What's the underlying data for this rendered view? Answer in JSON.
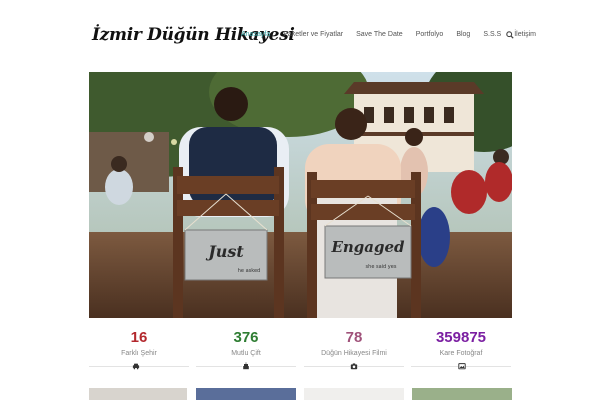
{
  "site": {
    "logo_text": "İzmir Düğün Hikayesi"
  },
  "nav": {
    "items": [
      {
        "label": "Anasayfa",
        "active": true
      },
      {
        "label": "Paketler ve Fiyatlar",
        "active": false
      },
      {
        "label": "Save The Date",
        "active": false
      },
      {
        "label": "Portfolyo",
        "active": false
      },
      {
        "label": "Blog",
        "active": false
      },
      {
        "label": "S.S.S",
        "active": false
      },
      {
        "label": "İletişim",
        "active": false
      }
    ],
    "search_icon": "search-icon",
    "active_color": "#3aa6a6"
  },
  "hero": {
    "signs": {
      "left": "Just",
      "right": "Engaged",
      "left_small": "he asked",
      "right_small": "she said yes"
    }
  },
  "stats": [
    {
      "value": "16",
      "label": "Farklı Şehir",
      "color": "#b3282d",
      "icon": "car-icon"
    },
    {
      "value": "376",
      "label": "Mutlu Çift",
      "color": "#2e7d32",
      "icon": "cake-icon"
    },
    {
      "value": "78",
      "label": "Düğün Hikayesi Filmi",
      "color": "#a0527a",
      "icon": "camera-icon"
    },
    {
      "value": "359875",
      "label": "Kare Fotoğraf",
      "color": "#7b1fa2",
      "icon": "photo-icon"
    }
  ]
}
